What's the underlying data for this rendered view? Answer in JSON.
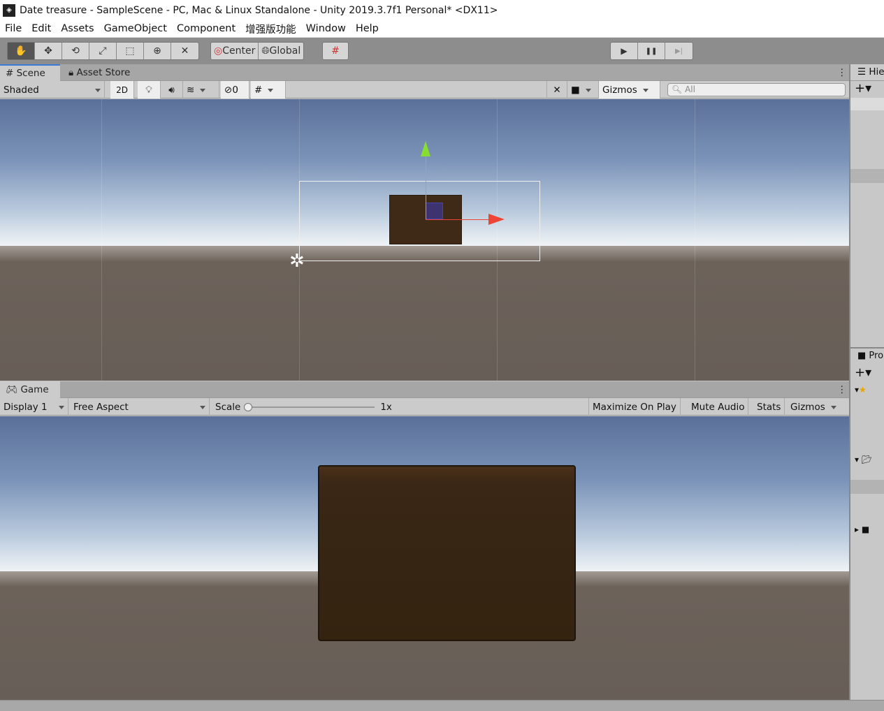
{
  "window": {
    "title": "Date treasure - SampleScene - PC, Mac & Linux Standalone - Unity 2019.3.7f1 Personal* <DX11>"
  },
  "menu": [
    "File",
    "Edit",
    "Assets",
    "GameObject",
    "Component",
    "增强版功能",
    "Window",
    "Help"
  ],
  "toolbar": {
    "tools": [
      "hand-tool",
      "move-tool",
      "rotate-tool",
      "scale-tool",
      "rect-tool",
      "transform-tool",
      "custom-tool"
    ],
    "pivot": "Center",
    "space": "Global",
    "play": "▶",
    "pause": "❚❚",
    "step": "▶|"
  },
  "scene": {
    "tabs": [
      "Scene",
      "Asset Store"
    ],
    "shading": "Shaded",
    "mode_2d": "2D",
    "hidden_count": "0",
    "gizmos": "Gizmos",
    "search_placeholder": "All"
  },
  "game": {
    "tab": "Game",
    "display": "Display 1",
    "aspect": "Free Aspect",
    "scale_label": "Scale",
    "scale_value": "1x",
    "scale_fraction": 0,
    "maximize": "Maximize On Play",
    "mute": "Mute Audio",
    "stats": "Stats",
    "gizmos": "Gizmos"
  },
  "hierarchy": {
    "tab": "Hie"
  },
  "project": {
    "tab": "Pro"
  }
}
